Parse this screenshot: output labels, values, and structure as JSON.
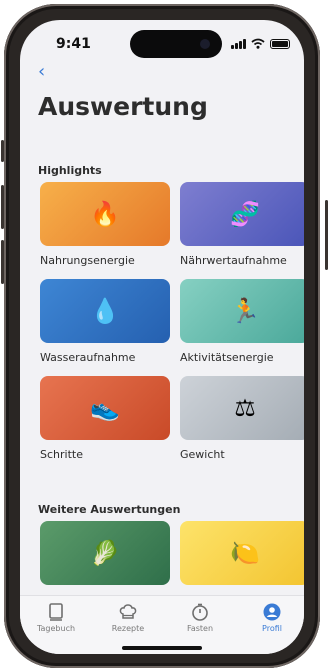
{
  "status": {
    "time": "9:41"
  },
  "nav": {
    "back_icon": "chevron-left-icon",
    "back_glyph": "‹"
  },
  "page": {
    "title": "Auswertung"
  },
  "highlights": {
    "heading": "Highlights",
    "cards": [
      {
        "label": "Nahrungsenergie",
        "icon": "flame-icon",
        "emoji": "🔥",
        "color_from": "#f7b04a",
        "color_to": "#e5792a"
      },
      {
        "label": "Nährwertaufnahme",
        "icon": "dna-icon",
        "emoji": "🧬",
        "color_from": "#7e7ed0",
        "color_to": "#4a55b8"
      },
      {
        "label": "Wasseraufnahme",
        "icon": "droplet-icon",
        "emoji": "💧",
        "color_from": "#3e86d4",
        "color_to": "#2560b0"
      },
      {
        "label": "Aktivitätsenergie",
        "icon": "runner-icon",
        "emoji": "🏃",
        "color_from": "#86d0c2",
        "color_to": "#4aa89a"
      },
      {
        "label": "Schritte",
        "icon": "sneaker-icon",
        "emoji": "👟",
        "color_from": "#e77450",
        "color_to": "#c94a28"
      },
      {
        "label": "Gewicht",
        "icon": "scale-icon",
        "emoji": "⚖",
        "color_from": "#cdd2d8",
        "color_to": "#a4acb4"
      }
    ]
  },
  "more": {
    "heading": "Weitere Auswertungen",
    "cards": [
      {
        "icon": "leafy-greens-icon",
        "emoji": "🥬",
        "color_from": "#5b9b6a",
        "color_to": "#2f6f4a"
      },
      {
        "icon": "lemon-icon",
        "emoji": "🍋",
        "color_from": "#fde36a",
        "color_to": "#f3c430"
      }
    ]
  },
  "tabbar": {
    "tabs": [
      {
        "label": "Tagebuch",
        "icon": "book-icon",
        "active": false
      },
      {
        "label": "Rezepte",
        "icon": "chef-hat-icon",
        "active": false
      },
      {
        "label": "Fasten",
        "icon": "stopwatch-icon",
        "active": false
      },
      {
        "label": "Profil",
        "icon": "person-icon",
        "active": true
      }
    ]
  }
}
